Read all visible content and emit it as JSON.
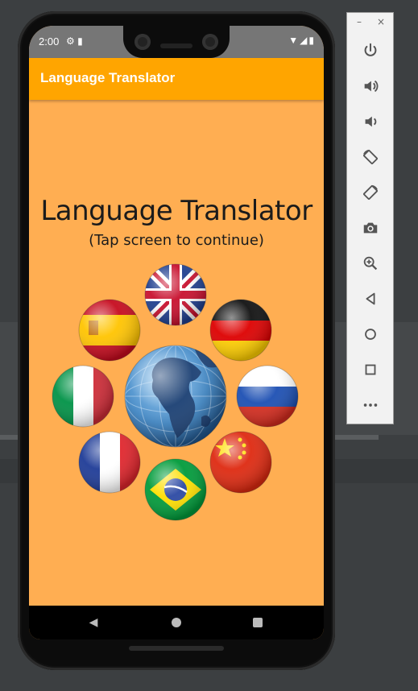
{
  "status_bar": {
    "time": "2:00"
  },
  "app_bar": {
    "title": "Language Translator"
  },
  "splash": {
    "headline": "Language Translator",
    "subtitle": "(Tap screen to continue)"
  },
  "flags": [
    "united-kingdom",
    "germany",
    "russia",
    "china",
    "brazil",
    "france",
    "italy",
    "spain"
  ],
  "toolbar": {
    "minimize": "–",
    "close": "×",
    "buttons": [
      "power",
      "volume-up",
      "volume-down",
      "rotate-left",
      "rotate-right",
      "screenshot",
      "zoom",
      "back",
      "home",
      "overview",
      "more"
    ]
  },
  "colors": {
    "app_bar": "#ffa500",
    "screen_bg": "#ffae52"
  }
}
